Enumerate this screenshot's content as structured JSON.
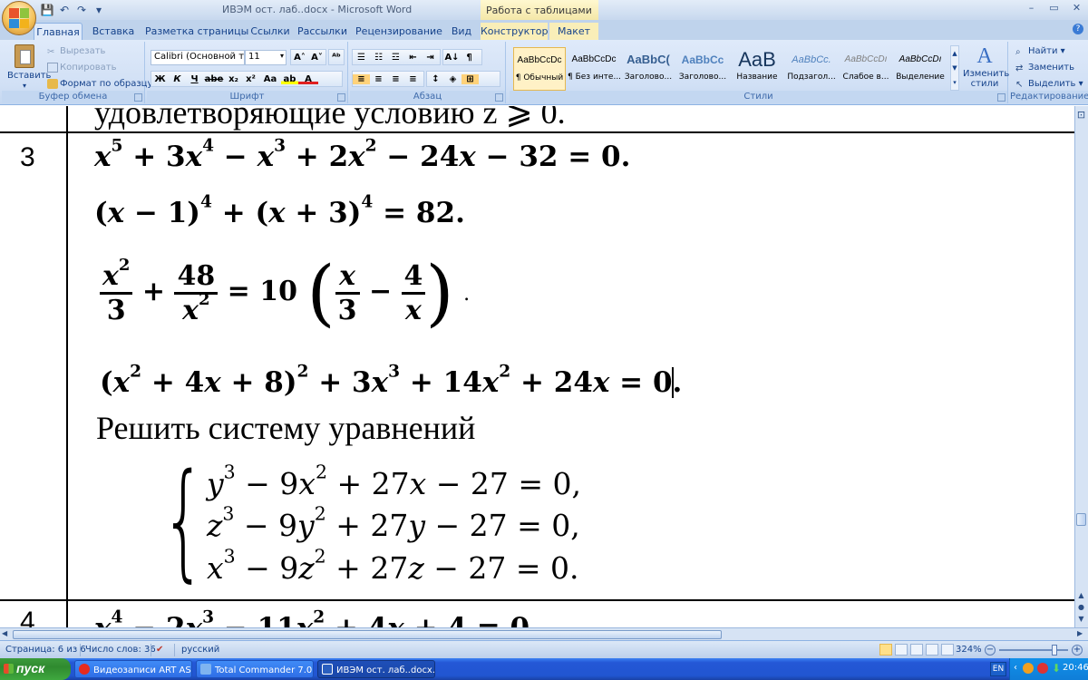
{
  "window": {
    "title": "ИВЭМ ост. лаб..docx - Microsoft Word",
    "context_tab_title": "Работа с таблицами",
    "controls": [
      "–",
      "▭",
      "✕"
    ]
  },
  "quick_access": [
    "save-icon",
    "undo-icon",
    "redo-icon",
    "customize-icon"
  ],
  "tabs": [
    {
      "label": "Главная",
      "active": true
    },
    {
      "label": "Вставка"
    },
    {
      "label": "Разметка страницы"
    },
    {
      "label": "Ссылки"
    },
    {
      "label": "Рассылки"
    },
    {
      "label": "Рецензирование"
    },
    {
      "label": "Вид"
    },
    {
      "label": "Конструктор"
    },
    {
      "label": "Макет"
    }
  ],
  "ribbon": {
    "clipboard": {
      "paste": "Вставить",
      "cut": "Вырезать",
      "copy": "Копировать",
      "format_painter": "Формат по образцу",
      "label": "Буфер обмена"
    },
    "font": {
      "font_name": "Calibri (Основной те",
      "font_size": "11",
      "label": "Шрифт",
      "buttons_row2": [
        "Ж",
        "К",
        "Ч",
        "abe",
        "x₂",
        "x²",
        "Aa"
      ]
    },
    "paragraph": {
      "label": "Абзац"
    },
    "styles": {
      "label": "Стили",
      "tiles": [
        {
          "sample": "AaBbCcDc",
          "name": "¶ Обычный",
          "selected": true
        },
        {
          "sample": "AaBbCcDc",
          "name": "¶ Без инте..."
        },
        {
          "sample": "AaBbC(",
          "name": "Заголово..."
        },
        {
          "sample": "AaBbCc",
          "name": "Заголово..."
        },
        {
          "sample": "AaB",
          "name": "Название"
        },
        {
          "sample": "AaBbCc.",
          "name": "Подзагол..."
        },
        {
          "sample": "AaBbCcDı",
          "name": "Слабое в..."
        },
        {
          "sample": "AaBbCcDı",
          "name": "Выделение"
        }
      ],
      "change_styles": "Изменить стили"
    },
    "editing": {
      "label": "Редактирование",
      "find": "Найти",
      "replace": "Заменить",
      "select": "Выделить"
    }
  },
  "document": {
    "top_text": "удовлетворяющие условию z ⩾ 0.",
    "row3_number": "3",
    "row4_number": "4",
    "system_intro": "Решить систему уравнений"
  },
  "statusbar": {
    "page": "Страница: 6 из 6",
    "words": "Число слов: 36",
    "language": "русский",
    "zoom": "324%"
  },
  "taskbar": {
    "start": "пуск",
    "tasks": [
      {
        "label": "Видеозаписи ART AS..."
      },
      {
        "label": "Total Commander 7.0..."
      },
      {
        "label": "ИВЭМ ост. лаб..docx...",
        "active": true
      }
    ],
    "lang": "EN",
    "time": "20:46"
  }
}
